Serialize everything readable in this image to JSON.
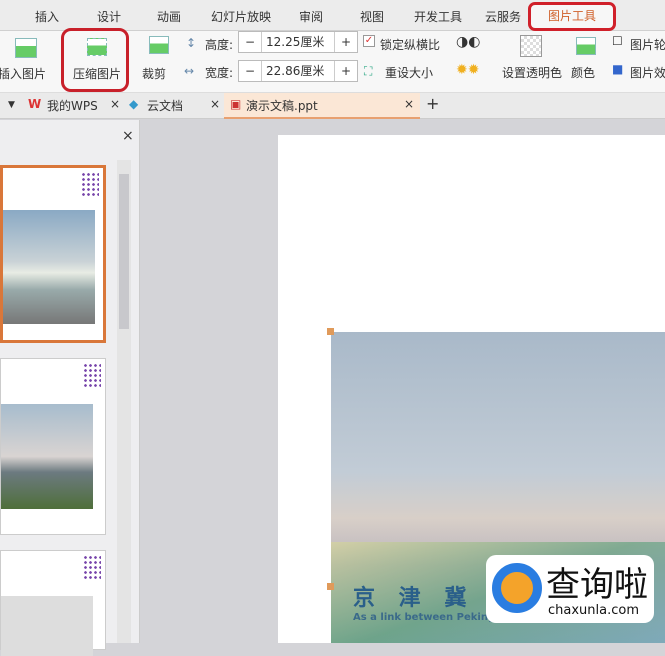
{
  "menu": {
    "tabs": [
      "插入",
      "设计",
      "动画",
      "幻灯片放映",
      "审阅",
      "视图",
      "开发工具",
      "云服务",
      "图片工具"
    ]
  },
  "toolbar": {
    "insert_picture": "插入图片",
    "compress_picture": "压缩图片",
    "crop": "裁剪",
    "height_label": "高度:",
    "height_value": "12.25厘米",
    "width_label": "宽度:",
    "width_value": "22.86厘米",
    "lock_ratio": "锁定纵横比",
    "reset_size": "重设大小",
    "set_transparent": "设置透明色",
    "color": "颜色",
    "picture_outline": "图片轮",
    "picture_effects": "图片效",
    "minus": "−",
    "plus": "+"
  },
  "doctabs": {
    "tabs": [
      "我的WPS",
      "云文档",
      "演示文稿.ppt"
    ],
    "close": "×",
    "add": "+"
  },
  "panel": {
    "close": "×"
  },
  "slide": {
    "title_text": "京 津 冀",
    "subtitle": "As a link between Peking and Tianjin, the inn"
  },
  "watermark": {
    "brand": "查询啦",
    "url": "chaxunla.com"
  }
}
